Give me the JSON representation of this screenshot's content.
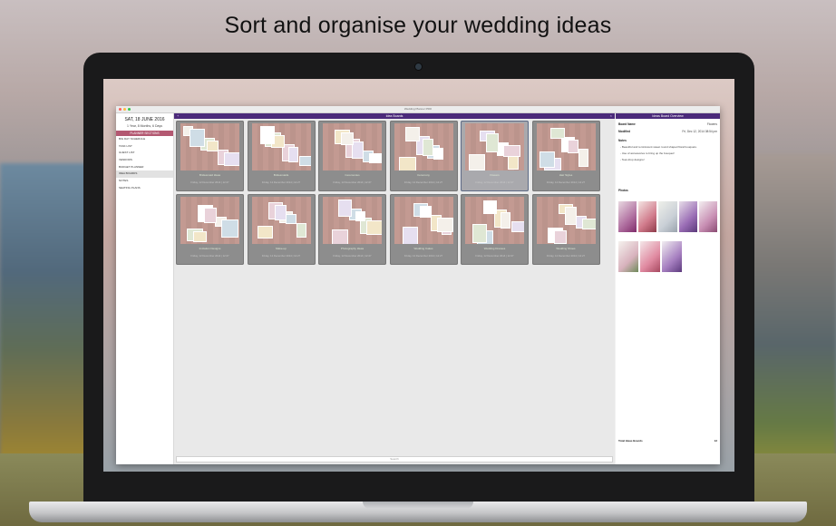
{
  "headline": "Sort and organise your wedding ideas",
  "window": {
    "title": "Wedding Planner PRO",
    "traffic_lights": [
      "#fc605c",
      "#fdbc40",
      "#34c84a"
    ]
  },
  "sidebar": {
    "date": "SAT, 18 JUNE 2016",
    "countdown": "1 Year, 8 Months, 6 Days",
    "section_title": "PLANNER SECTIONS",
    "items": [
      {
        "label": "BIG DAY SCHEDULE",
        "active": false
      },
      {
        "label": "TASK LIST",
        "active": false
      },
      {
        "label": "GUEST LIST",
        "active": false
      },
      {
        "label": "VENDORS",
        "active": false
      },
      {
        "label": "BUDGET PLANNER",
        "active": false
      },
      {
        "label": "IDEA BOARDS",
        "active": true
      },
      {
        "label": "NOTES",
        "active": false
      },
      {
        "label": "SEATING PLANS",
        "active": false
      }
    ]
  },
  "boards": {
    "title": "Idea Boards",
    "add_icon": "plus-icon",
    "close_icon": "close-icon",
    "search_placeholder": "Search",
    "cards": [
      {
        "name": "Bridesmaid Ideas",
        "date": "Friday, 12 December 2014 | 12:27",
        "selected": false
      },
      {
        "name": "Bridesmaids",
        "date": "Friday, 12 December 2014 | 12:27",
        "selected": false
      },
      {
        "name": "Ceremonies",
        "date": "Friday, 12 December 2014 | 12:27",
        "selected": false
      },
      {
        "name": "Ceremony",
        "date": "Friday, 12 December 2014 | 12:27",
        "selected": false
      },
      {
        "name": "Flowers",
        "date": "Friday, 12 December 2014 | 12:27",
        "selected": true
      },
      {
        "name": "Hair Styles",
        "date": "Friday, 12 December 2014 | 12:27",
        "selected": false
      },
      {
        "name": "Invitation Designs",
        "date": "Friday, 12 December 2014 | 12:27",
        "selected": false
      },
      {
        "name": "Make-up",
        "date": "Friday, 12 December 2014 | 12:27",
        "selected": false
      },
      {
        "name": "Photography Ideas",
        "date": "Friday, 12 December 2014 | 12:27",
        "selected": false
      },
      {
        "name": "Wedding Cakes",
        "date": "Friday, 12 December 2014 | 12:27",
        "selected": false
      },
      {
        "name": "Wedding Dresses",
        "date": "Friday, 12 December 2014 | 12:27",
        "selected": false
      },
      {
        "name": "Wedding Shoes",
        "date": "Friday, 12 December 2014 | 12:27",
        "selected": false
      }
    ]
  },
  "details": {
    "title": "Ideas Board Overview",
    "board_name_label": "Board Name",
    "board_name_value": "Flowers",
    "modified_label": "Modified",
    "modified_value": "Fri, Dec 12, 2014 08:54 pm",
    "notes_label": "Notes",
    "notes": [
      "- Beautiful and reminiscent sweet round shaped floral bouquets.",
      "- Use of accessories to bring up the bouquet!",
      "- Tear-drop designs!"
    ],
    "photos_label": "Photos",
    "total_label": "Total Ideas Boards",
    "total_value": "12"
  }
}
